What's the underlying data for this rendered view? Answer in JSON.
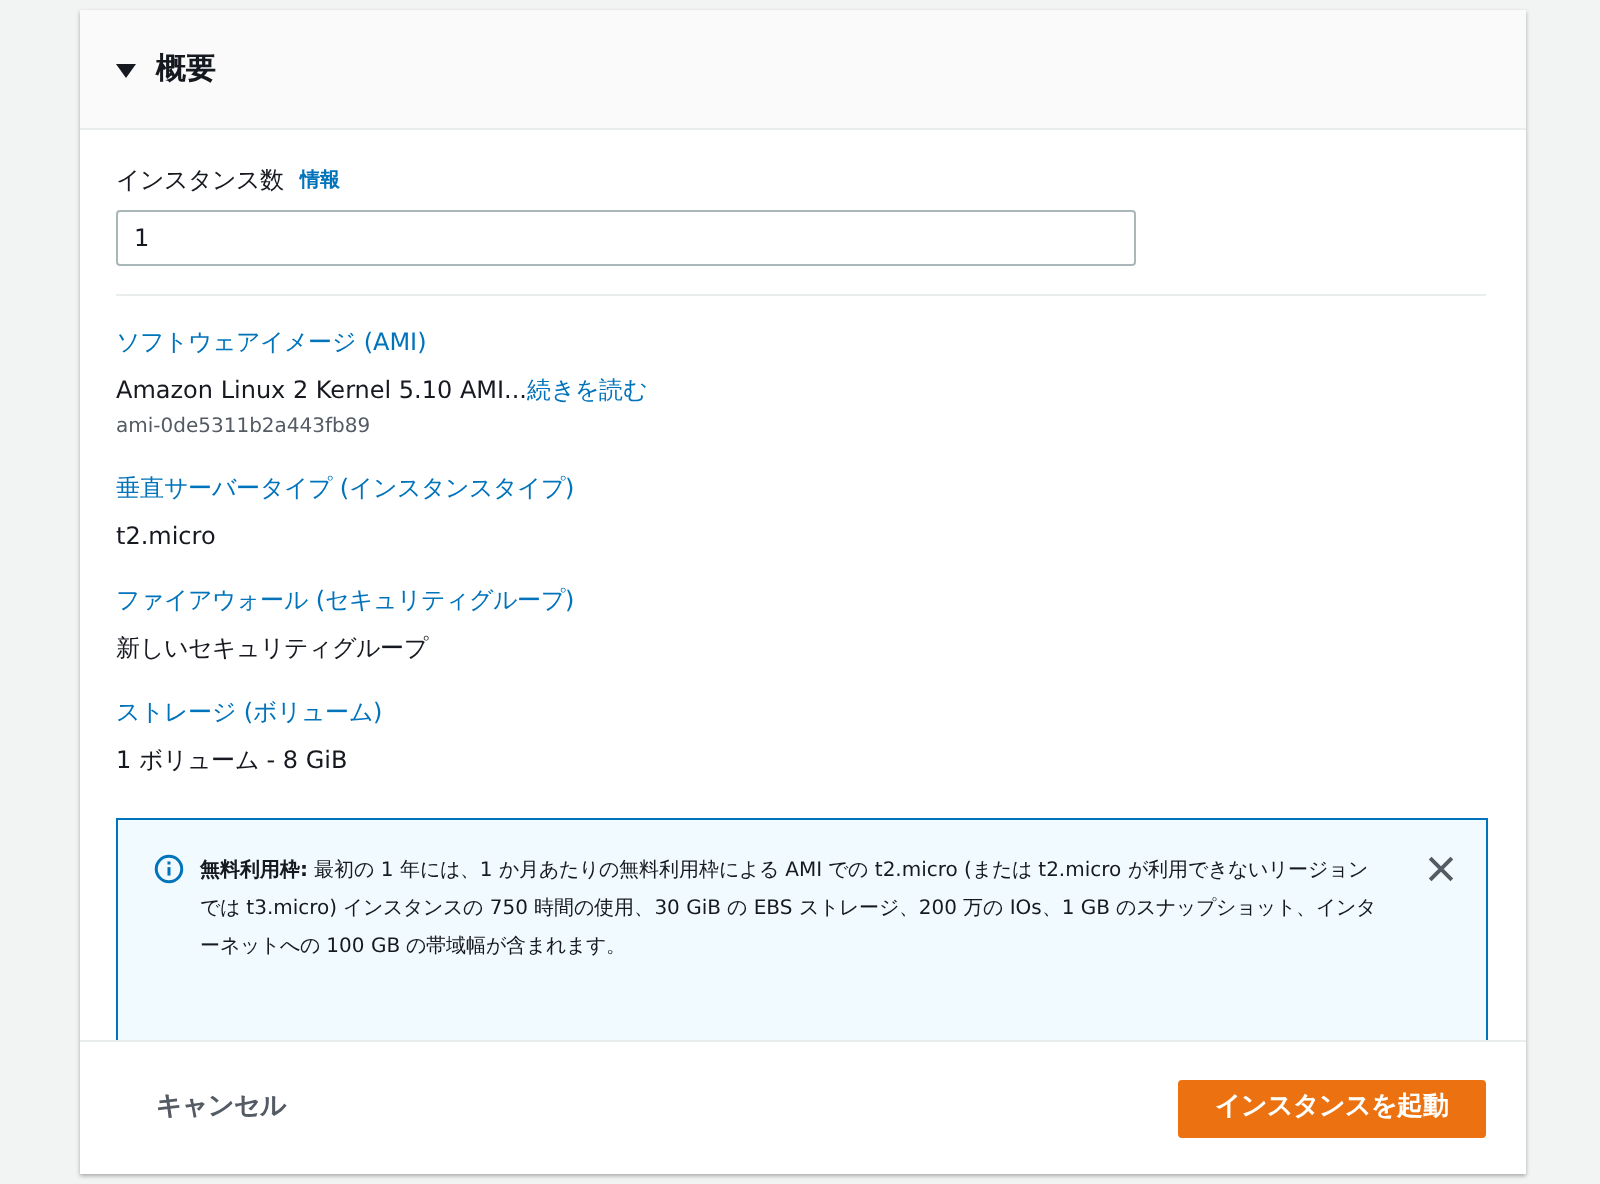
{
  "section": {
    "title": "概要",
    "expanded": true
  },
  "instance_count": {
    "label": "インスタンス数",
    "info_link": "情報",
    "value": "1"
  },
  "summary_items": [
    {
      "title": "ソフトウェアイメージ (AMI)",
      "value": "Amazon Linux 2 Kernel 5.10 AMI...",
      "more_link": "続きを読む",
      "sub": "ami-0de5311b2a443fb89"
    },
    {
      "title": "垂直サーバータイプ (インスタンスタイプ)",
      "value": "t2.micro"
    },
    {
      "title": "ファイアウォール (セキュリティグループ)",
      "value": "新しいセキュリティグループ"
    },
    {
      "title": "ストレージ (ボリューム)",
      "value": "1 ボリューム - 8 GiB"
    }
  ],
  "info_alert": {
    "text": "**無料利用枠:** 最初の 1 年には、1 か月あたりの無料利用枠による AMI での t2.micro (または t2.micro が利用できないリージョンでは t3.micro) インスタンスの 750 時間の使用、30 GiB の EBS ストレージ、200 万の IOs、1 GB のスナップショット、インターネットへの 100 GB の帯域幅が含まれます。"
  },
  "footer": {
    "cancel": "キャンセル",
    "launch": "インスタンスを起動"
  }
}
